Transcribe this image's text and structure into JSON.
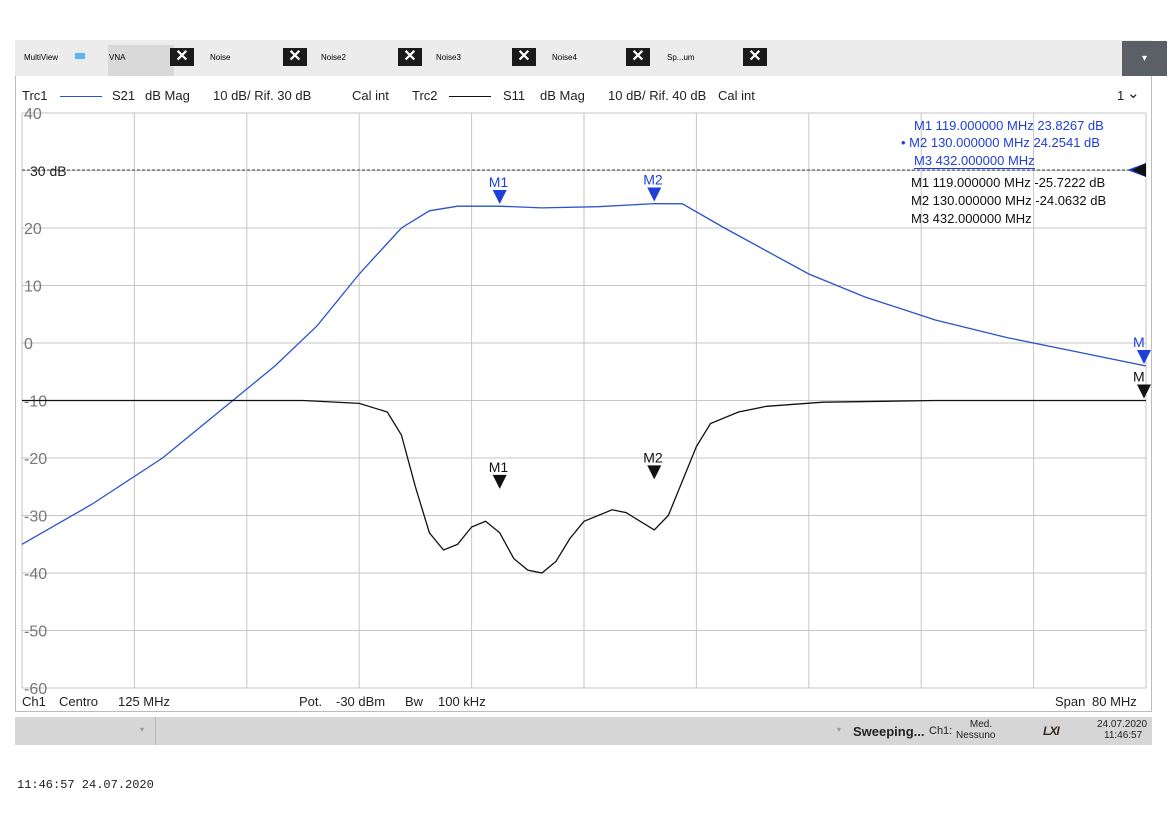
{
  "tabs": {
    "multiview": "MultiView",
    "items": [
      "VNA",
      "Noise",
      "Noise2",
      "Noise3",
      "Noise4",
      "Sp...um"
    ],
    "close_glyph": "✕",
    "dropdown_glyph": "▾"
  },
  "trace_header": {
    "trc1_name": "Trc1",
    "trc1_param": "S21",
    "trc1_format": "dB Mag",
    "trc1_scale": "10 dB/ Rif. 30 dB",
    "trc1_cal": "Cal int",
    "trc2_name": "Trc2",
    "trc2_param": "S11",
    "trc2_format": "dB Mag",
    "trc2_scale": "10 dB/ Rif. 40 dB",
    "trc2_cal": "Cal int",
    "window_number": "1",
    "window_chevron": "⌄"
  },
  "ref_label": "30 dB",
  "marker_readouts": {
    "trc1": [
      "M1  119.000000  MHz  23.8267  dB",
      "• M2  130.000000  MHz  24.2541  dB",
      "M3  432.000000  MHz"
    ],
    "trc2": [
      "M1  119.000000  MHz  -25.7222  dB",
      "M2  130.000000  MHz  -24.0632  dB",
      "M3  432.000000  MHz"
    ]
  },
  "footer": {
    "channel": "Ch1",
    "center_label": "Centro",
    "center_value": "125 MHz",
    "power_label": "Pot.",
    "power_value": "-30 dBm",
    "bw_label": "Bw",
    "bw_value": "100 kHz",
    "span_label": "Span",
    "span_value": "80 MHz"
  },
  "statusbar": {
    "sweep_status": "Sweeping...",
    "ch_label": "Ch1:",
    "avg_line1": "Med.",
    "avg_line2": "Nessuno",
    "lxi": "LXI",
    "date": "24.07.2020",
    "time": "11:46:57"
  },
  "timestamp": "11:46:57   24.07.2020",
  "colors": {
    "trc1": "#2a53c9",
    "trc2": "#111111",
    "marker_blue": "#1f3fd8",
    "grid": "#c6c6c6"
  },
  "chart_data": {
    "type": "line",
    "ylim": [
      -60,
      40
    ],
    "y_ticks": [
      40,
      20,
      10,
      0,
      -10,
      -20,
      -30,
      -40,
      -50,
      -60
    ],
    "x_range_mhz": [
      85,
      165
    ],
    "x_divisions": 10,
    "series": [
      {
        "name": "Trc1",
        "points": [
          [
            85,
            -35
          ],
          [
            90,
            -28
          ],
          [
            95,
            -20
          ],
          [
            100,
            -10
          ],
          [
            103,
            -4
          ],
          [
            106,
            3
          ],
          [
            109,
            12
          ],
          [
            112,
            20
          ],
          [
            114,
            23
          ],
          [
            116,
            23.8
          ],
          [
            119,
            23.8
          ],
          [
            122,
            23.5
          ],
          [
            126,
            23.7
          ],
          [
            130,
            24.25
          ],
          [
            132,
            24.2
          ],
          [
            135,
            20
          ],
          [
            138,
            16
          ],
          [
            141,
            12
          ],
          [
            145,
            8
          ],
          [
            150,
            4
          ],
          [
            155,
            1
          ],
          [
            160,
            -1.5
          ],
          [
            165,
            -4
          ]
        ],
        "markers": [
          {
            "name": "M1",
            "x": 119,
            "y": 23.8267
          },
          {
            "name": "M2",
            "x": 130,
            "y": 24.2541
          },
          {
            "name": "M",
            "x": 165,
            "y": -4
          }
        ]
      },
      {
        "name": "Trc2",
        "points": [
          [
            85,
            -10
          ],
          [
            105,
            -10
          ],
          [
            109,
            -10.5
          ],
          [
            111,
            -12
          ],
          [
            112,
            -16
          ],
          [
            113,
            -25
          ],
          [
            114,
            -33
          ],
          [
            115,
            -36
          ],
          [
            116,
            -35
          ],
          [
            117,
            -32
          ],
          [
            118,
            -31
          ],
          [
            119,
            -33
          ],
          [
            120,
            -37.5
          ],
          [
            121,
            -39.5
          ],
          [
            122,
            -40
          ],
          [
            123,
            -38
          ],
          [
            124,
            -34
          ],
          [
            125,
            -31
          ],
          [
            127,
            -29
          ],
          [
            128,
            -29.5
          ],
          [
            129,
            -31
          ],
          [
            130,
            -32.5
          ],
          [
            131,
            -30
          ],
          [
            132,
            -24
          ],
          [
            133,
            -18
          ],
          [
            134,
            -14
          ],
          [
            136,
            -12
          ],
          [
            138,
            -11
          ],
          [
            142,
            -10.3
          ],
          [
            150,
            -10
          ],
          [
            165,
            -10
          ]
        ],
        "markers": [
          {
            "name": "M1",
            "x": 119,
            "y": -25.7222
          },
          {
            "name": "M2",
            "x": 130,
            "y": -24.0632
          },
          {
            "name": "M",
            "x": 165,
            "y": -10
          }
        ]
      }
    ]
  }
}
